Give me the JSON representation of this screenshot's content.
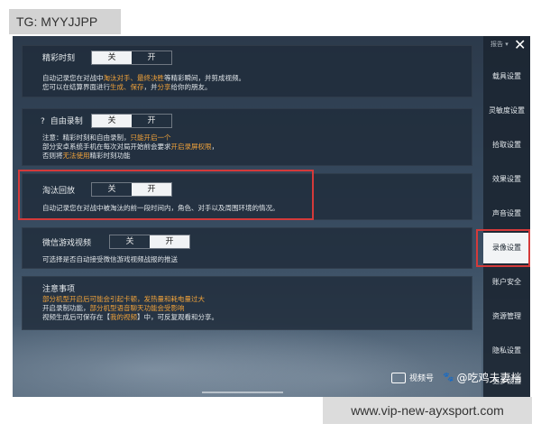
{
  "tag": "TG: MYYJJPP",
  "url": "www.vip-new-ayxsport.com",
  "sidebar": {
    "top_label": "报告 ▾",
    "items": [
      "载具设置",
      "灵敏度设置",
      "拾取设置",
      "效果设置",
      "声音设置",
      "录像设置",
      "账户安全",
      "资源管理",
      "隐私设置",
      "更多设置"
    ],
    "active": "录像设置"
  },
  "toggle": {
    "off": "关",
    "on": "开"
  },
  "sections": {
    "highlight": {
      "title": "精彩时刻",
      "line1": [
        "自动记录您在对战中",
        "淘汰对手、最终决胜",
        "等精彩瞬间，并剪成视频。"
      ],
      "line2": [
        "您可以在结算界面进行",
        "生成、保存",
        "，并",
        "分享",
        "给你的朋友。"
      ]
    },
    "free_record": {
      "question": "?",
      "title": "自由录制",
      "line1": [
        "注意：精彩时刻和自由录制，",
        "只能开启一个"
      ],
      "line2": [
        "部分安卓系统手机在每次对局开始前会要求",
        "开启录屏权限",
        "，"
      ],
      "line3": [
        "否则将",
        "无法使用",
        "精彩时刻功能"
      ]
    },
    "elimination": {
      "title": "淘汰回放",
      "line1": "自动记录您在对战中被淘汰的前一段时间内，角色、对手以及周围环境的情况。"
    },
    "wechat": {
      "title": "微信游戏视频",
      "line1": "可选择是否自动接受微信游戏视频战报的推送"
    },
    "notice": {
      "title": "注意事项",
      "line1": "部分机型开启后可能会引起卡顿，发热量和耗电量过大",
      "line2": [
        "开启录制功能，",
        "部分机型语音聊天功能会受影响"
      ],
      "line3": [
        "视频生成后可保存在【",
        "我的视频",
        "】中，可反复观看和分享。"
      ]
    }
  },
  "watermark": {
    "channel": "视频号",
    "author": "@吃鸡夫妻档"
  }
}
